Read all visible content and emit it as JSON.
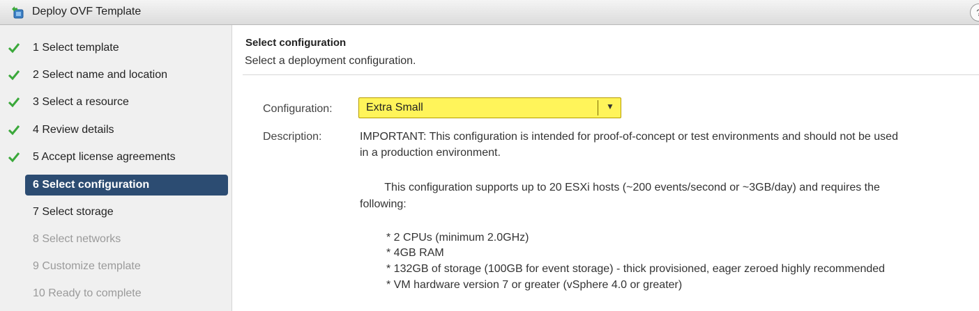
{
  "window": {
    "title": "Deploy OVF Template",
    "help_glyph": "?"
  },
  "colors": {
    "accent": "#2c4c72",
    "check": "#3aa83a",
    "highlight": "#fff45a"
  },
  "steps": [
    {
      "label": "1  Select template",
      "state": "done"
    },
    {
      "label": "2  Select name and location",
      "state": "done"
    },
    {
      "label": "3  Select a resource",
      "state": "done"
    },
    {
      "label": "4  Review details",
      "state": "done"
    },
    {
      "label": "5  Accept license agreements",
      "state": "done"
    },
    {
      "label": "6  Select configuration",
      "state": "current"
    },
    {
      "label": "7  Select storage",
      "state": "todo"
    },
    {
      "label": "8  Select networks",
      "state": "disabled"
    },
    {
      "label": "9  Customize template",
      "state": "disabled"
    },
    {
      "label": "10  Ready to complete",
      "state": "disabled"
    }
  ],
  "main": {
    "title": "Select configuration",
    "subtitle": "Select a deployment configuration.",
    "configuration_label": "Configuration:",
    "configuration_value": "Extra Small",
    "description_label": "Description:",
    "description_lines": [
      "IMPORTANT: This configuration is intended for proof-of-concept or test environments and should not be used",
      "in a production environment.",
      "        This configuration supports up to 20 ESXi hosts (~200 events/second or ~3GB/day) and requires the",
      "following:",
      "* 2 CPUs (minimum 2.0GHz)",
      "* 4GB RAM",
      "* 132GB of storage (100GB for event storage) - thick provisioned, eager zeroed highly recommended",
      "* VM hardware version 7 or greater (vSphere 4.0 or greater)"
    ]
  }
}
